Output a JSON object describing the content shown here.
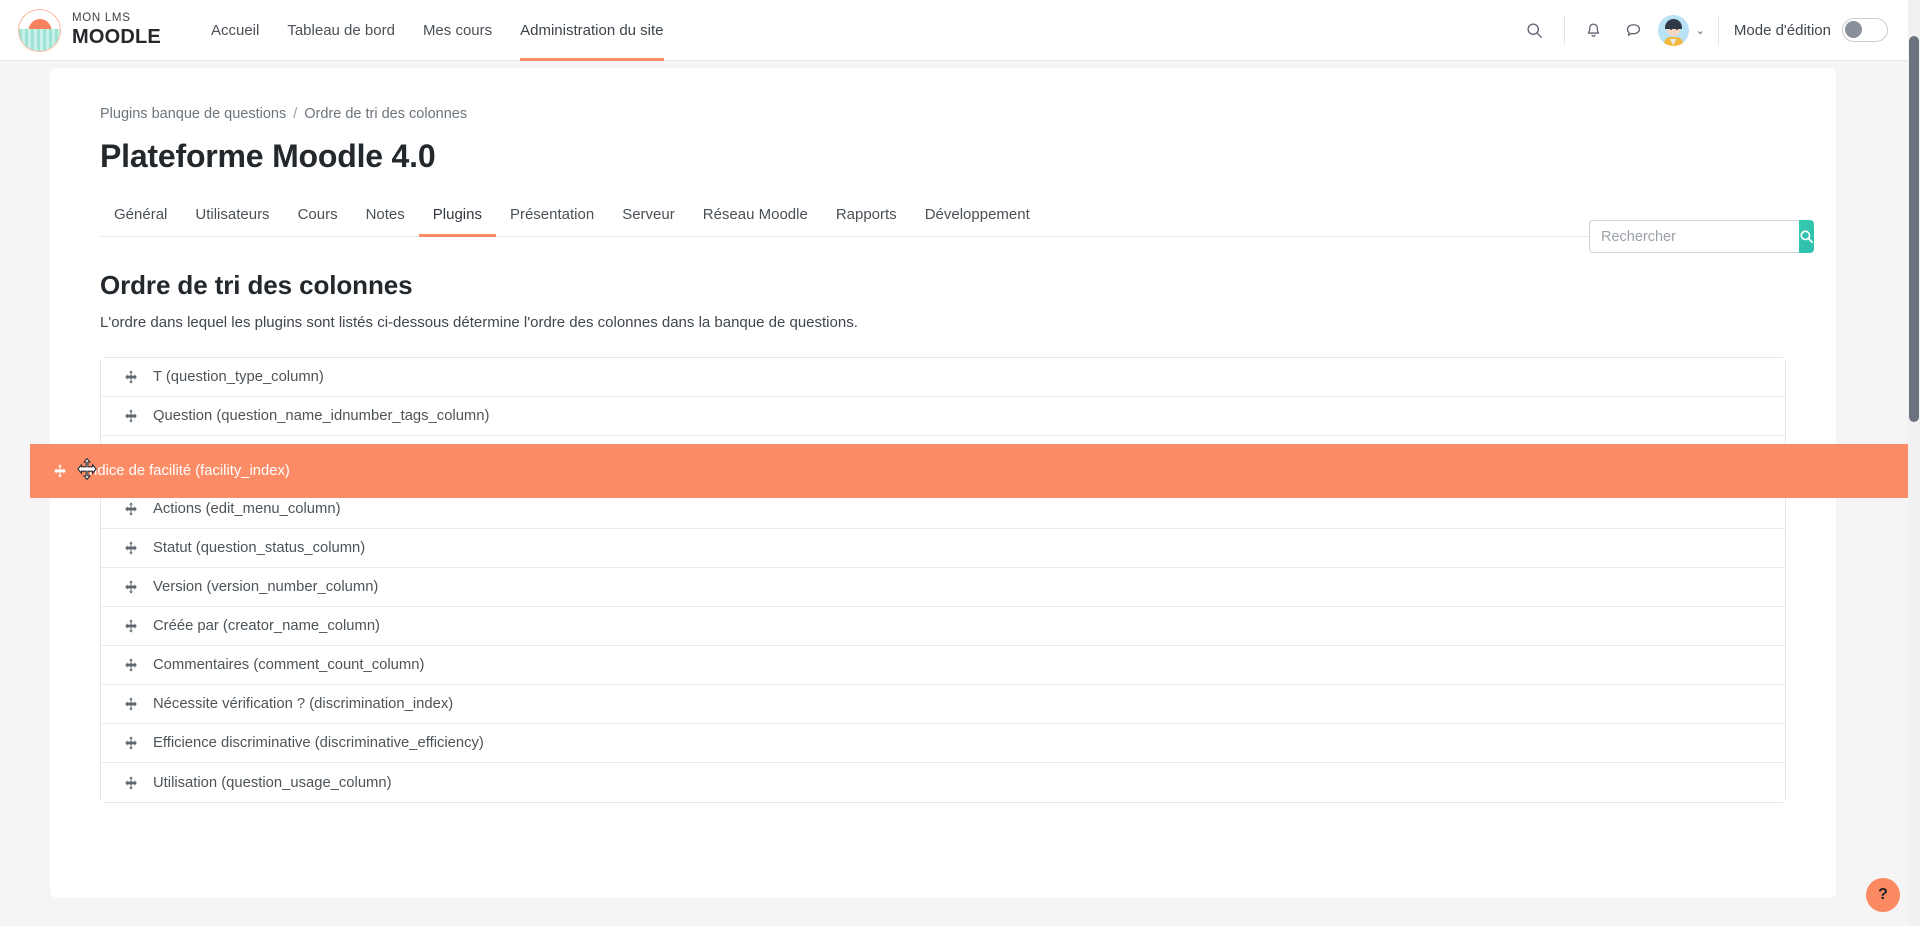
{
  "navbar": {
    "brand": {
      "line1": "MON LMS",
      "line2": "MOODLE",
      "icon": "moodle-logo-icon"
    },
    "links": [
      {
        "label": "Accueil",
        "active": false
      },
      {
        "label": "Tableau de bord",
        "active": false
      },
      {
        "label": "Mes cours",
        "active": false
      },
      {
        "label": "Administration du site",
        "active": true
      }
    ],
    "icons": [
      {
        "name": "search-icon"
      },
      {
        "name": "notifications-bell-icon"
      },
      {
        "name": "messages-bubble-icon"
      }
    ],
    "avatar": {
      "name": "user-avatar",
      "chevron": "⌄"
    },
    "edit_mode": {
      "label": "Mode d'édition",
      "state": "off"
    }
  },
  "breadcrumb": {
    "parent": "Plugins banque de questions",
    "separator": "/",
    "current": "Ordre de tri des colonnes"
  },
  "page": {
    "title": "Plateforme Moodle 4.0"
  },
  "search": {
    "placeholder": "Rechercher",
    "value": "",
    "button_icon": "search-icon"
  },
  "tabs": [
    {
      "label": "Général",
      "active": false
    },
    {
      "label": "Utilisateurs",
      "active": false
    },
    {
      "label": "Cours",
      "active": false
    },
    {
      "label": "Notes",
      "active": false
    },
    {
      "label": "Plugins",
      "active": true
    },
    {
      "label": "Présentation",
      "active": false
    },
    {
      "label": "Serveur",
      "active": false
    },
    {
      "label": "Réseau Moodle",
      "active": false
    },
    {
      "label": "Rapports",
      "active": false
    },
    {
      "label": "Développement",
      "active": false
    }
  ],
  "section": {
    "title": "Ordre de tri des colonnes",
    "description": "L'ordre dans lequel les plugins sont listés ci-dessous détermine l'ordre des colonnes dans la banque de questions."
  },
  "sortable_list": {
    "dragging_item": {
      "label": "Indice de facilité (facility_index)",
      "handle_icon": "drag-move-icon",
      "background_color": "#fc8c66",
      "text_color": "#ffffff"
    },
    "items": [
      {
        "label": "T (question_type_column)",
        "handle_icon": "drag-move-icon"
      },
      {
        "label": "Question (question_name_idnumber_tags_column)",
        "handle_icon": "drag-move-icon"
      },
      {
        "label": "Actions (edit_menu_column)",
        "handle_icon": "drag-move-icon"
      },
      {
        "label": "Statut (question_status_column)",
        "handle_icon": "drag-move-icon"
      },
      {
        "label": "Version (version_number_column)",
        "handle_icon": "drag-move-icon"
      },
      {
        "label": "Créée par (creator_name_column)",
        "handle_icon": "drag-move-icon"
      },
      {
        "label": "Commentaires (comment_count_column)",
        "handle_icon": "drag-move-icon"
      },
      {
        "label": "Nécessite vérification ? (discrimination_index)",
        "handle_icon": "drag-move-icon"
      },
      {
        "label": "Efficience discriminative (discriminative_efficiency)",
        "handle_icon": "drag-move-icon"
      },
      {
        "label": "Utilisation (question_usage_column)",
        "handle_icon": "drag-move-icon"
      }
    ]
  },
  "help_button": {
    "label": "?",
    "icon": "question-mark-icon"
  },
  "colors": {
    "accent_orange": "#f98b66",
    "drag_highlight": "#fc8c66",
    "teal_button": "#35c9ad",
    "text_dark": "#23282d",
    "text_muted": "#6c757d"
  }
}
